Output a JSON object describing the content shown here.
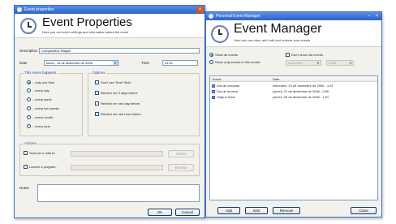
{
  "event_properties": {
    "window_title": "Event properties",
    "header_title": "Event Properties",
    "header_subtitle": "Here you can enter settings and information about the event",
    "description_label": "Description",
    "description_value": "Cumpleaños Raquel",
    "date_label": "Date",
    "date_value": "lunes , 18 de diciembre de 2006",
    "time_label": "Time",
    "time_value": "01:01",
    "happens_group_title": "This event happens...",
    "happens_options": [
      "...only one time",
      "...every day",
      "...every week",
      "...every two weeks",
      "...every month",
      "...every year"
    ],
    "happens_selected_index": 0,
    "options_group_title": "Options",
    "option_checkboxes": [
      "Don't use \"time\" field",
      "Remind me 3 days before",
      "Remind me one day before",
      "Remind me one hour before"
    ],
    "actions_group_title": "Actions",
    "action_send_email": "Send an e-mail to:",
    "action_launch_program": "Launch a program:",
    "select_button": "Select",
    "browse_button": "Browse",
    "notes_label": "Notes",
    "ok_button": "OK",
    "cancel_button": "Cancel"
  },
  "event_manager": {
    "window_title": "Personal Event Manager",
    "header_title": "Event Manager",
    "header_subtitle": "Here you can view, add, edit and remove your events",
    "filter_show_all": "Show all events",
    "filter_show_month": "Show only events in this month:",
    "filter_selected": "all",
    "dont_show_old": "Don't show old events",
    "month_value": "diciembre",
    "year_value": "2006",
    "columns": [
      "Event",
      "Date"
    ],
    "events": [
      {
        "name": "Día de compras",
        "date": "miércoles, 20 de diciembre de 2006 - 1:01"
      },
      {
        "name": "Día de la cena",
        "date": "jueves, 21 de diciembre de 2006 - 0:59"
      },
      {
        "name": "Viaje a Soria",
        "date": "jueves, 28 de diciembre de 2006 - 1:01"
      }
    ],
    "add_button": "Add",
    "edit_button": "Edit",
    "remove_button": "Remove",
    "close_button": "Close"
  }
}
